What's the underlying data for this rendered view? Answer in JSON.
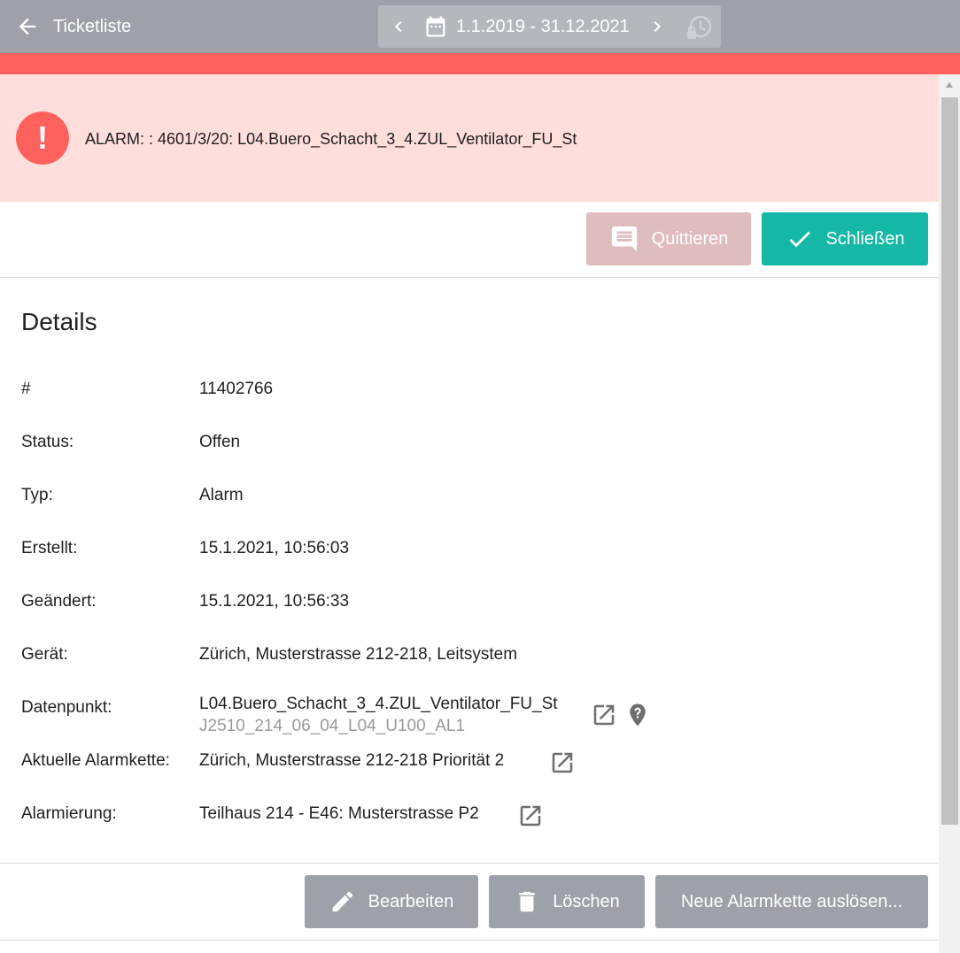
{
  "header": {
    "back_label": "Ticketliste",
    "date_range": "1.1.2019 - 31.12.2021",
    "icons": {
      "back": "arrow-left-icon",
      "prev": "chevron-left-icon",
      "calendar": "calendar-icon",
      "next": "chevron-right-icon",
      "history": "history-icon"
    }
  },
  "alarm": {
    "text": "ALARM: : 4601/3/20: L04.Buero_Schacht_3_4.ZUL_Ventilator_FU_St",
    "icon": "exclamation-icon"
  },
  "actions": {
    "quittieren_label": "Quittieren",
    "schliessen_label": "Schließen"
  },
  "details": {
    "title": "Details",
    "rows": [
      {
        "label": "#",
        "value": "11402766"
      },
      {
        "label": "Status:",
        "value": "Offen"
      },
      {
        "label": "Typ:",
        "value": "Alarm"
      },
      {
        "label": "Erstellt:",
        "value": "15.1.2021, 10:56:03"
      },
      {
        "label": "Geändert:",
        "value": "15.1.2021, 10:56:33"
      },
      {
        "label": "Gerät:",
        "value": "Zürich, Musterstrasse 212-218, Leitsystem"
      },
      {
        "label": "Datenpunkt:",
        "value": "L04.Buero_Schacht_3_4.ZUL_Ventilator_FU_St",
        "sub": "J2510_214_06_04_L04_U100_AL1"
      },
      {
        "label": "Aktuelle Alarmkette:",
        "value": "Zürich, Musterstrasse 212-218 Priorität 2"
      },
      {
        "label": "Alarmierung:",
        "value": "Teilhaus 214 - E46: Musterstrasse P2"
      }
    ]
  },
  "bottom_actions": {
    "bearbeiten_label": "Bearbeiten",
    "loeschen_label": "Löschen",
    "neue_label": "Neue Alarmkette auslösen..."
  },
  "colors": {
    "header_bg": "#9ea1a9",
    "alarm_red": "#ff625c",
    "alarm_bg": "#ffdedc",
    "teal": "#15b8a6",
    "quittieren_disabled": "#dfbcbe"
  }
}
